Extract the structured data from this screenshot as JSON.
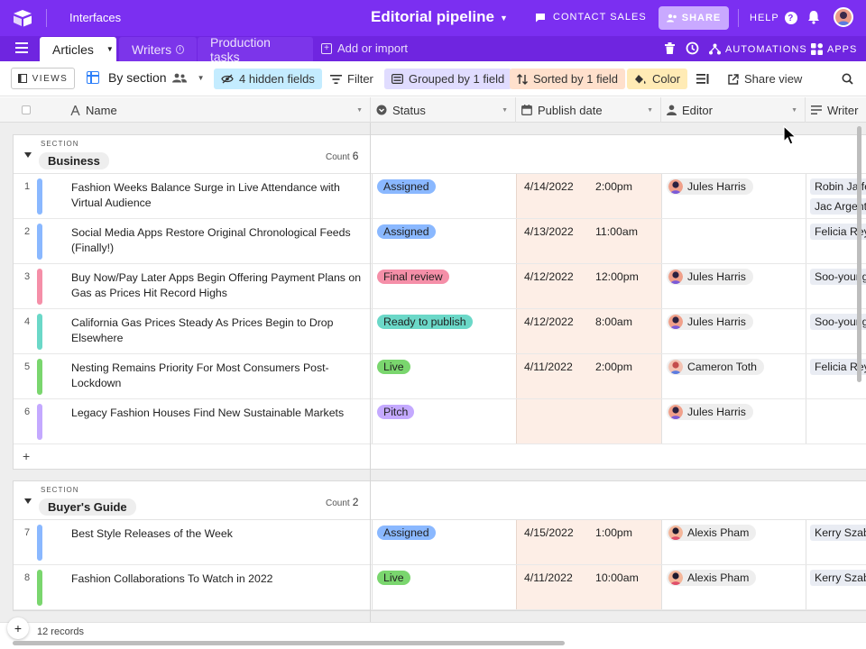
{
  "topbar": {
    "interfaces_label": "Interfaces",
    "base_title": "Editorial pipeline",
    "contact_sales": "CONTACT SALES",
    "share": "SHARE",
    "help": "HELP"
  },
  "tabs": {
    "active": "Articles",
    "writers": "Writers",
    "production": "Production tasks",
    "add_import": "Add or import",
    "automations": "AUTOMATIONS",
    "apps": "APPS"
  },
  "toolbar": {
    "views": "VIEWS",
    "view_name": "By section",
    "hidden_fields": "4 hidden fields",
    "filter": "Filter",
    "grouped": "Grouped by 1 field",
    "sorted": "Sorted by 1 field",
    "color": "Color",
    "share_view": "Share view"
  },
  "columns": {
    "name": "Name",
    "status": "Status",
    "publish_date": "Publish date",
    "editor": "Editor",
    "writer": "Writer"
  },
  "sections": [
    {
      "label": "SECTION",
      "name": "Business",
      "count_label": "Count",
      "count": "6"
    },
    {
      "label": "SECTION",
      "name": "Buyer's Guide",
      "count_label": "Count",
      "count": "2"
    }
  ],
  "rows": [
    {
      "num": "1",
      "name": "Fashion Weeks Balance Surge in Live Attendance with Virtual Audience",
      "status": "Assigned",
      "date": "4/14/2022",
      "time": "2:00pm",
      "editor": "Jules Harris",
      "writers": [
        "Robin Jaffe",
        "Jac Argent"
      ],
      "bar_color": "#8ab8ff"
    },
    {
      "num": "2",
      "name": "Social Media Apps Restore Original Chronological Feeds (Finally!)",
      "status": "Assigned",
      "date": "4/13/2022",
      "time": "11:00am",
      "editor": "",
      "writers": [
        "Felicia Reyes"
      ],
      "bar_color": "#8ab8ff"
    },
    {
      "num": "3",
      "name": "Buy Now/Pay Later Apps Begin Offering Payment Plans on Gas as Prices Hit Record Highs",
      "status": "Final review",
      "date": "4/12/2022",
      "time": "12:00pm",
      "editor": "Jules Harris",
      "writers": [
        "Soo-young"
      ],
      "bar_color": "#f58fa8"
    },
    {
      "num": "4",
      "name": "California Gas Prices Steady As Prices Begin to Drop Elsewhere",
      "status": "Ready to publish",
      "date": "4/12/2022",
      "time": "8:00am",
      "editor": "Jules Harris",
      "writers": [
        "Soo-young"
      ],
      "bar_color": "#6bd8c8"
    },
    {
      "num": "5",
      "name": "Nesting Remains Priority For Most Consumers Post-Lockdown",
      "status": "Live",
      "date": "4/11/2022",
      "time": "2:00pm",
      "editor": "Cameron Toth",
      "writers": [
        "Felicia Reyes"
      ],
      "bar_color": "#7ad66e"
    },
    {
      "num": "6",
      "name": "Legacy Fashion Houses Find New Sustainable Markets",
      "status": "Pitch",
      "date": "",
      "time": "",
      "editor": "Jules Harris",
      "writers": [],
      "bar_color": "#c4a9ff"
    },
    {
      "num": "7",
      "name": "Best Style Releases of the Week",
      "status": "Assigned",
      "date": "4/15/2022",
      "time": "1:00pm",
      "editor": "Alexis Pham",
      "writers": [
        "Kerry Szabo"
      ],
      "bar_color": "#8ab8ff"
    },
    {
      "num": "8",
      "name": "Fashion Collaborations To Watch in 2022",
      "status": "Live",
      "date": "4/11/2022",
      "time": "10:00am",
      "editor": "Alexis Pham",
      "writers": [
        "Kerry Szabo"
      ],
      "bar_color": "#7ad66e"
    }
  ],
  "status_colors": {
    "Assigned": "#8ab8ff",
    "Final review": "#f58fa8",
    "Ready to publish": "#6bd8c8",
    "Live": "#7ad66e",
    "Pitch": "#c4a9ff"
  },
  "footer": {
    "records": "12 records"
  }
}
